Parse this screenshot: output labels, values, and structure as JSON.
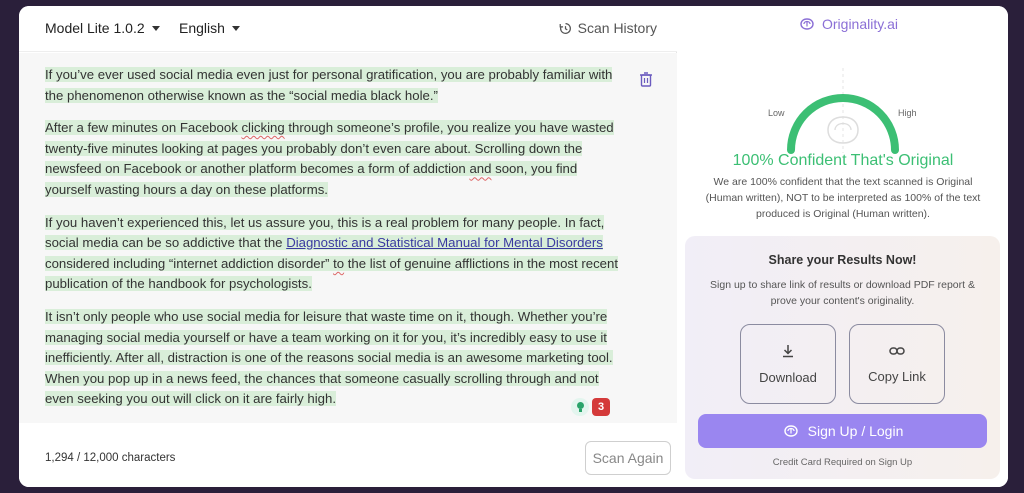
{
  "toolbar": {
    "model_label": "Model Lite 1.0.2",
    "language_label": "English",
    "history_label": "Scan History"
  },
  "editor": {
    "paragraphs": [
      {
        "text": "If you’ve ever used social media even just for personal gratification, you are probably familiar with the phenomenon otherwise known as the “social media black hole.”"
      },
      {
        "part1": "After a few minutes on Facebook ",
        "squiggle1": "clicking",
        "part2": " through someone’s profile, you realize you have wasted twenty-five minutes looking at pages you probably don’t even care about. Scrolling down the newsfeed on Facebook or another platform becomes a form of addiction ",
        "squiggle2": "and",
        "part3": " soon, you find yourself wasting hours a day on these platforms."
      },
      {
        "part1": "If you haven’t experienced this, let us assure you, this is a real problem for many people. In fact, social media can be so addictive that the ",
        "link": "Diagnostic and Statistical Manual for Mental Disorders",
        "part2": " considered including “internet addiction disorder” ",
        "squiggle": "to",
        "part3": " the list of genuine afflictions in the most recent publication of the handbook for psychologists."
      },
      {
        "text": "It isn’t only people who use social media for leisure that waste time on it, though. Whether you’re managing social media yourself or have a team working on it for you, it’s incredibly easy to use it inefficiently. After all, distraction is one of the reasons social media is an awesome marketing tool. When you pop up in a news feed, the chances that someone casually scrolling through and not even seeking you out will click on it are fairly high."
      }
    ],
    "issue_count": "3"
  },
  "footer": {
    "char_count": "1,294 / 12,000 characters",
    "scan_again_label": "Scan Again"
  },
  "result": {
    "brand": "Originality.ai",
    "gauge_low": "Low",
    "gauge_high": "High",
    "confidence_text": "100% Confident That's Original",
    "confidence_level": 1.0,
    "description": "We are 100% confident that the text scanned is Original (Human written), NOT to be interpreted as 100% of the text produced is Original (Human written)."
  },
  "share": {
    "title": "Share your Results Now!",
    "description": "Sign up to share link of results or download PDF report & prove your content's originality.",
    "download_label": "Download",
    "copy_link_label": "Copy Link",
    "signup_label": "Sign Up / Login",
    "credit_note": "Credit Card Required on Sign Up"
  },
  "colors": {
    "accent": "#9a86f0",
    "success": "#3cbf74",
    "highlight": "#d9eed9",
    "brand": "#8b6fd6"
  }
}
